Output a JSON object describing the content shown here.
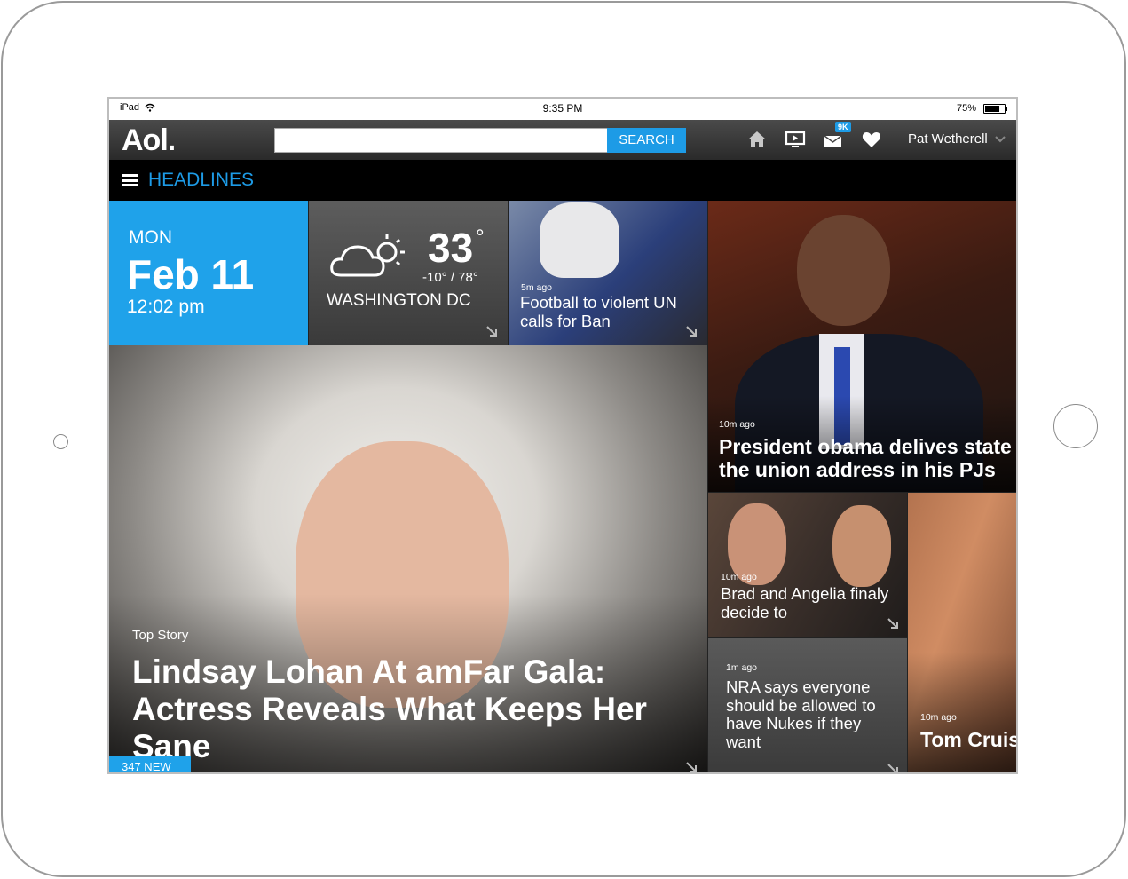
{
  "status": {
    "device": "iPad",
    "time": "9:35 PM",
    "battery": "75%",
    "battery_level": 0.75
  },
  "app": {
    "logo": "Aol.",
    "search": {
      "value": "",
      "placeholder": "",
      "button": "SEARCH"
    },
    "nav_icons": [
      "home-icon",
      "video-icon",
      "mail-icon",
      "heart-icon"
    ],
    "mail_badge": "9K",
    "user": "Pat Wetherell"
  },
  "section": {
    "title": "HEADLINES"
  },
  "date_tile": {
    "day": "MON",
    "date": "Feb 11",
    "time": "12:02 pm"
  },
  "weather_tile": {
    "temp": "33",
    "degree": "°",
    "range": "-10° / 78°",
    "city": "WASHINGTON DC"
  },
  "stories": {
    "football": {
      "age": "5m ago",
      "title": "Football to violent UN calls for Ban"
    },
    "obama": {
      "age": "10m ago",
      "title": "President obama delives state the union address in his PJs"
    },
    "top": {
      "label": "Top Story",
      "title": "Lindsay Lohan At amFar Gala: Actress Reveals What Keeps Her Sane"
    },
    "brad": {
      "age": "10m ago",
      "title": "Brad and Angelia finaly decide to"
    },
    "nra": {
      "age": "1m ago",
      "title": "NRA says everyone should be allowed to have Nukes if they want"
    },
    "tom": {
      "age": "10m ago",
      "title": "Tom Cruise really such"
    }
  },
  "new_badge": "347 NEW",
  "colors": {
    "accent": "#1d9be6"
  }
}
